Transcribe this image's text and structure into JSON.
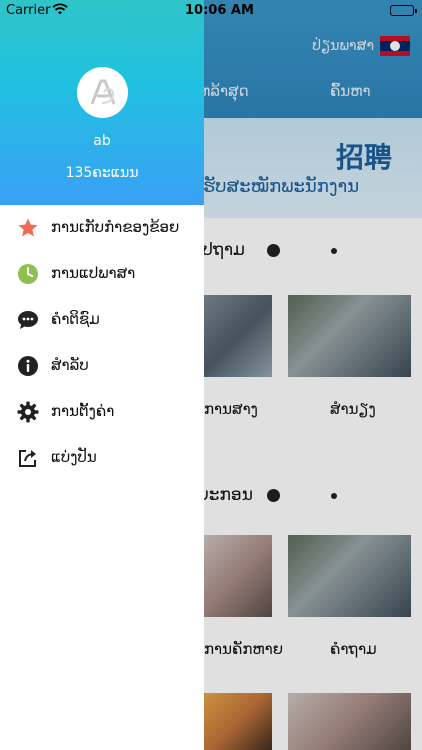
{
  "status_bar": {
    "carrier": "Carrier",
    "time": "10:06 AM"
  },
  "background": {
    "language_label": "ປ່ຽນພາສາ",
    "tabs": [
      "ຫລ້າສຸດ",
      "ຄົ້ນຫາ"
    ],
    "banner": {
      "chinese": "招聘",
      "lao": "ຮັບສະໝັກພະນັກງານ"
    },
    "sections": [
      {
        "title": "ທົ່ວໄປຖາມ",
        "captions": [
          "ການສາງ",
          "ສຳນຽງ"
        ]
      },
      {
        "title": "ໄວຍະກອນ",
        "captions": [
          "ການຄັກຫາຍ",
          "ຄຳຖາມ"
        ]
      }
    ]
  },
  "drawer": {
    "user": {
      "name": "ab",
      "points": "135ຄະແນນ"
    },
    "menu": [
      {
        "icon": "star-icon",
        "label": "ການເກັບກຳຂອງຂ້ອຍ",
        "color": "#f36b56"
      },
      {
        "icon": "clock-icon",
        "label": "ການແປພາສາ",
        "color": "#8cc152"
      },
      {
        "icon": "chat-icon",
        "label": "ຄຳຕິຊົມ",
        "color": "#222222"
      },
      {
        "icon": "info-icon",
        "label": "ສຳລັບ",
        "color": "#222222"
      },
      {
        "icon": "gear-icon",
        "label": "ການຕັ້ງຄ່າ",
        "color": "#222222"
      },
      {
        "icon": "share-icon",
        "label": "ແບ່ງປັນ",
        "color": "#222222"
      }
    ]
  },
  "colors": {
    "header_blue": "#2f86bd",
    "drawer_gradient_top": "#2fc4c8",
    "drawer_gradient_bottom": "#3aa0f5"
  }
}
